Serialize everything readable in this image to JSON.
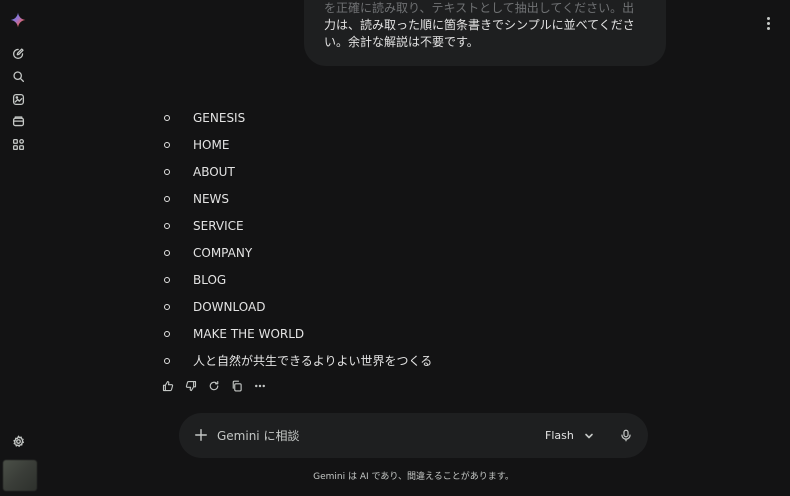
{
  "sidebar": {
    "icons": [
      "gemini-logo",
      "new-chat-icon",
      "search-icon",
      "gallery-icon",
      "gems-icon",
      "apps-icon",
      "settings-icon"
    ]
  },
  "conversation": {
    "user_message": {
      "line1": "を正確に読み取り、テキストとして抽出してください。出",
      "line2": "力は、読み取った順に箇条書きでシンプルに並べてくださ",
      "line3": "い。余計な解説は不要です。"
    },
    "response": {
      "items": [
        "GENESIS",
        "HOME",
        "ABOUT",
        "NEWS",
        "SERVICE",
        "COMPANY",
        "BLOG",
        "DOWNLOAD",
        "MAKE THE WORLD",
        "人と自然が共生できるよりよい世界をつくる"
      ],
      "action_icons": [
        "thumbs-up-icon",
        "thumbs-down-icon",
        "regenerate-icon",
        "copy-icon",
        "more-icon"
      ]
    }
  },
  "composer": {
    "placeholder": "Gemini に相談",
    "model": "Flash"
  },
  "footer": {
    "disclaimer": "Gemini は AI であり、間違えることがあります。"
  },
  "colors": {
    "background": "#131314",
    "surface": "#1e1f20",
    "text": "#e3e3e3",
    "muted": "#c4c7c5"
  }
}
